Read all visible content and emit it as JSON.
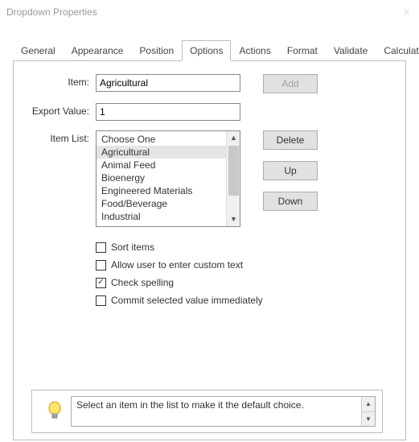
{
  "window": {
    "title": "Dropdown Properties"
  },
  "tabs": {
    "items": [
      "General",
      "Appearance",
      "Position",
      "Options",
      "Actions",
      "Format",
      "Validate",
      "Calculate"
    ],
    "active": "Options"
  },
  "labels": {
    "item": "Item:",
    "exportValue": "Export Value:",
    "itemList": "Item List:"
  },
  "fields": {
    "item": "Agricultural",
    "exportValue": "1"
  },
  "buttons": {
    "add": "Add",
    "delete": "Delete",
    "up": "Up",
    "down": "Down"
  },
  "itemList": {
    "entries": [
      "Choose One",
      "Agricultural",
      "Animal Feed",
      "Bioenergy",
      "Engineered Materials",
      "Food/Beverage",
      "Industrial"
    ],
    "selectedIndex": 1
  },
  "checkboxes": {
    "sortItems": {
      "label": "Sort items",
      "checked": false
    },
    "allowCustom": {
      "label": "Allow user to enter custom text",
      "checked": false
    },
    "checkSpelling": {
      "label": "Check spelling",
      "checked": true
    },
    "commitImmediate": {
      "label": "Commit selected value immediately",
      "checked": false
    }
  },
  "hint": {
    "text": "Select an item in the list to make it the default choice."
  }
}
